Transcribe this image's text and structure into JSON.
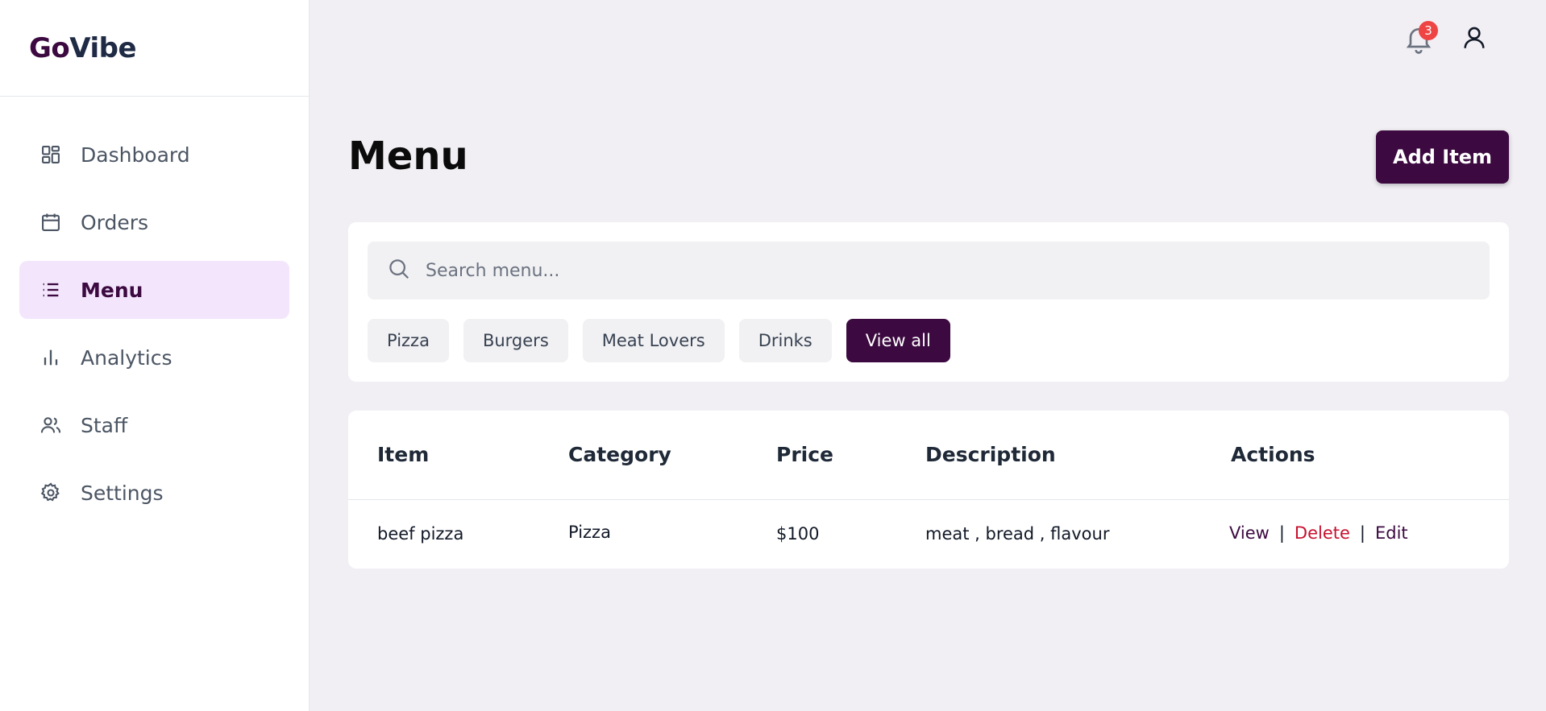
{
  "brand": {
    "go": "Go",
    "vibe": "Vibe",
    "go_color": "#3c0a40",
    "vibe_color": "#1f2a44"
  },
  "sidebar": {
    "items": [
      {
        "label": "Dashboard",
        "icon": "dashboard-grid-icon",
        "active": false
      },
      {
        "label": "Orders",
        "icon": "calendar-icon",
        "active": false
      },
      {
        "label": "Menu",
        "icon": "list-icon",
        "active": true
      },
      {
        "label": "Analytics",
        "icon": "bar-chart-icon",
        "active": false
      },
      {
        "label": "Staff",
        "icon": "users-icon",
        "active": false
      },
      {
        "label": "Settings",
        "icon": "gear-icon",
        "active": false
      }
    ]
  },
  "header": {
    "notification_count": "3"
  },
  "page": {
    "title": "Menu",
    "add_button": "Add Item"
  },
  "search": {
    "placeholder": "Search menu..."
  },
  "filters": {
    "chips": [
      "Pizza",
      "Burgers",
      "Meat Lovers",
      "Drinks",
      "View all"
    ],
    "active": "View all"
  },
  "table": {
    "columns": [
      "Item",
      "Category",
      "Price",
      "Description",
      "Actions"
    ],
    "rows": [
      {
        "item": "beef pizza",
        "category": "Pizza",
        "price": "$100",
        "description": "meat , bread , flavour"
      }
    ],
    "actions": {
      "view": "View",
      "delete": "Delete",
      "edit": "Edit",
      "separator": "|"
    }
  },
  "colors": {
    "accent": "#3c0a40",
    "active_nav_bg": "#f3e6fc",
    "danger": "#c8102e",
    "badge": "#ef4444",
    "page_bg": "#f1eff4"
  }
}
